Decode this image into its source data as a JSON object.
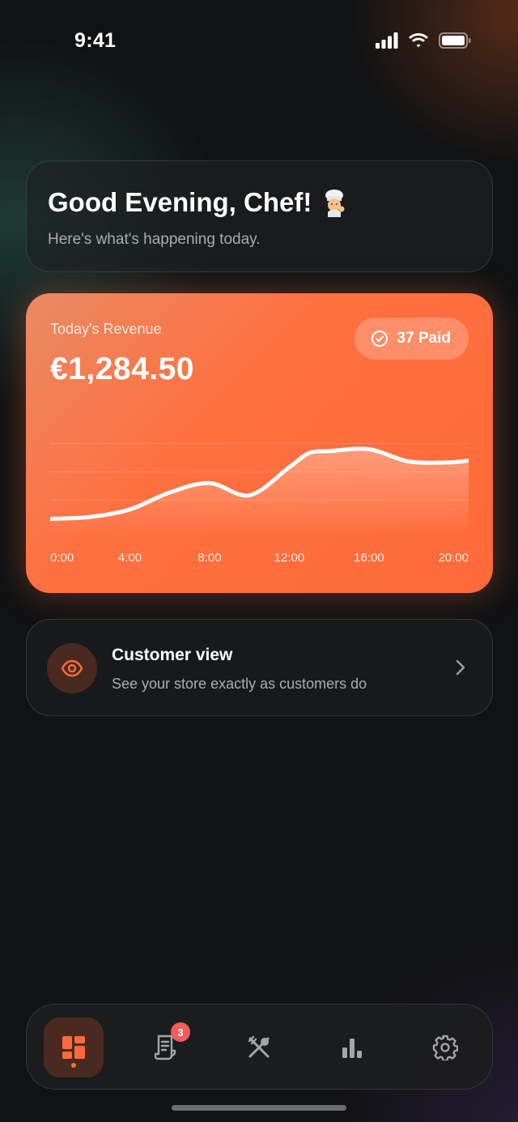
{
  "status_bar": {
    "time": "9:41"
  },
  "greeting": {
    "title": "Good Evening, Chef!",
    "emoji_icon": "chef-emoji-icon",
    "subtitle": "Here's what's happening today."
  },
  "revenue": {
    "label": "Today's Revenue",
    "amount": "€1,284.50",
    "paid_badge": "37 Paid",
    "accent_color": "#ff6a3a"
  },
  "chart_data": {
    "type": "area",
    "title": "",
    "xlabel": "",
    "ylabel": "",
    "x": [
      "0:00",
      "2:00",
      "4:00",
      "6:00",
      "8:00",
      "10:00",
      "12:00",
      "13:00",
      "14:00",
      "16:00",
      "18:00",
      "20:00",
      "21:00"
    ],
    "series": [
      {
        "values": [
          10,
          12,
          20,
          38,
          48,
          35,
          65,
          80,
          82,
          84,
          71,
          70,
          72
        ]
      }
    ],
    "ylim": [
      0,
      100
    ],
    "x_tick_labels": [
      "0:00",
      "4:00",
      "8:00",
      "12:00",
      "16:00",
      "20:00"
    ],
    "grid": true,
    "legend": "none"
  },
  "customer_view": {
    "title": "Customer view",
    "subtitle": "See your store exactly as customers do"
  },
  "nav": {
    "items": [
      {
        "icon": "dashboard-icon",
        "active": true
      },
      {
        "icon": "orders-receipt-icon",
        "badge": "3"
      },
      {
        "icon": "utensils-icon"
      },
      {
        "icon": "bar-chart-icon"
      },
      {
        "icon": "settings-gear-icon"
      }
    ]
  }
}
